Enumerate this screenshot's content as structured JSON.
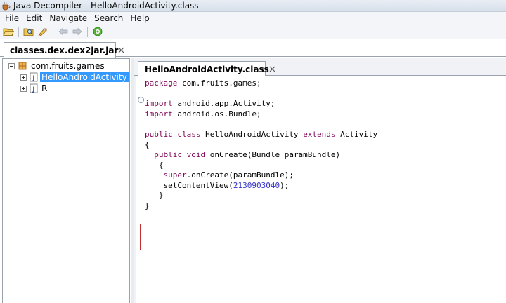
{
  "window": {
    "title": "Java Decompiler - HelloAndroidActivity.class"
  },
  "menu": {
    "items": [
      "File",
      "Edit",
      "Navigate",
      "Search",
      "Help"
    ]
  },
  "toolbar": {
    "buttons": [
      {
        "name": "open-file",
        "icon": "folder-open-icon"
      },
      {
        "name": "open-type",
        "icon": "folder-search-icon"
      },
      {
        "name": "open-type-hierarchy",
        "icon": "rocket-icon"
      },
      {
        "name": "back",
        "icon": "arrow-left-icon"
      },
      {
        "name": "forward",
        "icon": "arrow-right-icon"
      },
      {
        "name": "about",
        "icon": "check-circle-icon"
      }
    ]
  },
  "outer_tab": {
    "label": "classes.dex.dex2jar.jar"
  },
  "tree": {
    "package": "com.fruits.games",
    "classes": [
      {
        "label": "HelloAndroidActivity",
        "selected": true
      },
      {
        "label": "R",
        "selected": false
      }
    ]
  },
  "editor_tab": {
    "label": "HelloAndroidActivity.class"
  },
  "code": {
    "line1": {
      "kw": "package",
      "rest": " com.fruits.games;"
    },
    "line3": {
      "kw": "import",
      "rest": " android.app.Activity;"
    },
    "line4": {
      "kw": "import",
      "rest": " android.os.Bundle;"
    },
    "line6": {
      "kw1": "public class",
      "mid": " HelloAndroidActivity ",
      "kw2": "extends",
      "rest": " Activity"
    },
    "line7": "{",
    "line8": {
      "indent": "  ",
      "kw": "public void",
      "rest": " onCreate(Bundle paramBundle)"
    },
    "line9": "   {",
    "line10": {
      "indent": "    ",
      "kw": "super",
      "rest": ".onCreate(paramBundle);"
    },
    "line11": {
      "indent": "    ",
      "pre": "setContentView(",
      "num": "2130903040",
      "post": ");"
    },
    "line12": "   }",
    "line13": "}"
  },
  "colors": {
    "keyword": "#7f0055",
    "number": "#3333cc",
    "selection": "#3399ff",
    "fold_line": "#c03030"
  }
}
